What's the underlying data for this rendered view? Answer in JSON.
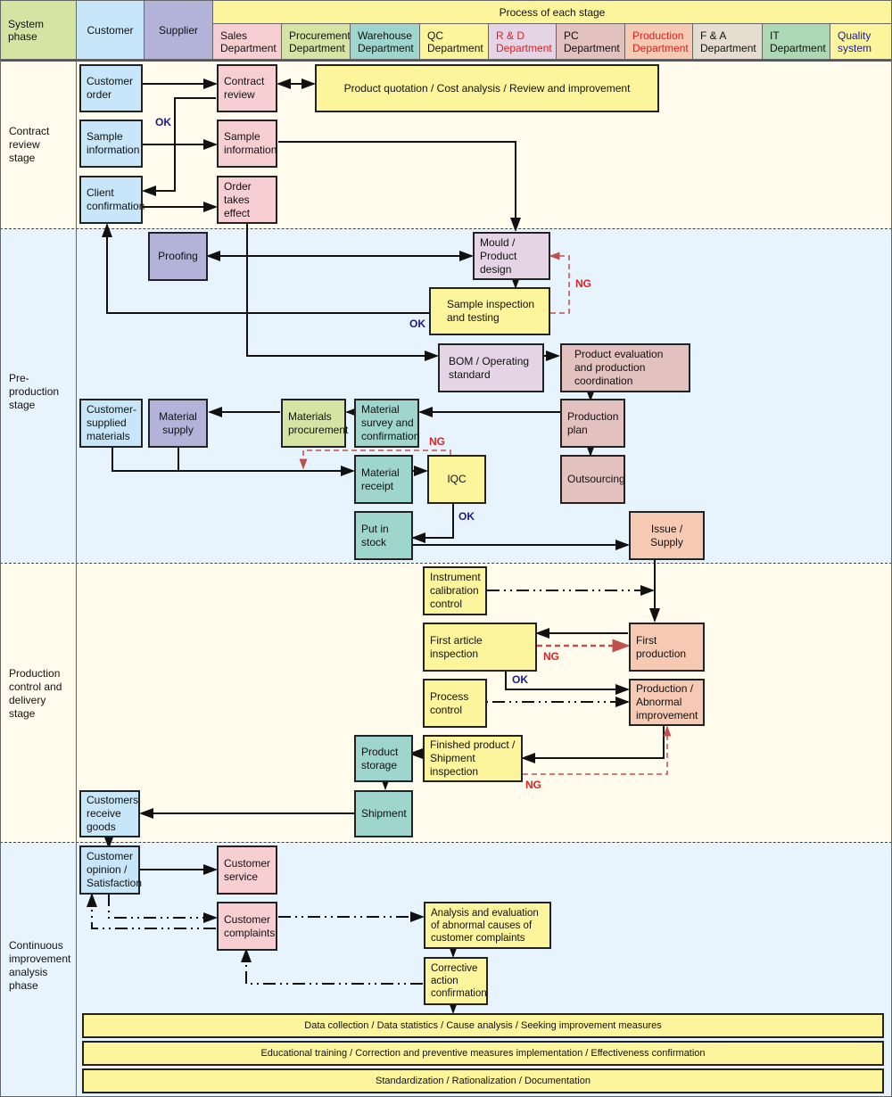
{
  "header": {
    "system_phase": "System phase",
    "customer": "Customer",
    "supplier": "Supplier",
    "process_title": "Process of each stage",
    "departments": [
      {
        "label": "Sales Department",
        "color": "#f7cfd3",
        "text_color": "#111111"
      },
      {
        "label": "Procurement Department",
        "color": "#d6e4a3",
        "text_color": "#111111"
      },
      {
        "label": "Warehouse Department",
        "color": "#9ed5cd",
        "text_color": "#111111"
      },
      {
        "label": "QC Department",
        "color": "#fdf59c",
        "text_color": "#111111"
      },
      {
        "label": "R & D Department",
        "color": "#e4d4e6",
        "text_color": "#e02020"
      },
      {
        "label": "PC Department",
        "color": "#e2c1bf",
        "text_color": "#111111"
      },
      {
        "label": "Production Department",
        "color": "#f6c9b3",
        "text_color": "#e02020"
      },
      {
        "label": "F & A Department",
        "color": "#e5ddd0",
        "text_color": "#111111"
      },
      {
        "label": "IT Department",
        "color": "#acd9b3",
        "text_color": "#111111"
      },
      {
        "label": "Quality system",
        "color": "#fdf59c",
        "text_color": "#1a1a9c"
      }
    ]
  },
  "phases": [
    {
      "label": "Contract review stage"
    },
    {
      "label": "Pre-production stage"
    },
    {
      "label": "Production control and delivery stage"
    },
    {
      "label": "Continuous improvement analysis phase"
    }
  ],
  "nodes": {
    "customer_order": "Customer order",
    "contract_review": "Contract review",
    "product_quotation": "Product quotation / Cost analysis / Review and improvement",
    "sample_info_customer": "Sample information",
    "sample_info_sales": "Sample information",
    "client_confirmation": "Client confirmation",
    "order_takes_effect": "Order takes effect",
    "proofing": "Proofing",
    "mould_design": "Mould / Product design",
    "sample_inspection": "Sample inspection and testing",
    "bom": "BOM / Operating standard",
    "product_evaluation": "Product evaluation and production coordination",
    "customer_supplied": "Customer-supplied materials",
    "material_supply": "Material supply",
    "materials_procurement": "Materials procurement",
    "material_survey": "Material survey and confirmation",
    "production_plan": "Production plan",
    "material_receipt": "Material receipt",
    "iqc": "IQC",
    "outsourcing": "Outsourcing",
    "put_in_stock": "Put in stock",
    "issue_supply": "Issue / Supply",
    "instrument_calibration": "Instrument calibration control",
    "first_article": "First article inspection",
    "first_production": "First production",
    "process_control": "Process control",
    "production_abnormal": "Production / Abnormal improvement",
    "product_storage": "Product storage",
    "finished_inspection": "Finished product / Shipment inspection",
    "customers_receive": "Customers receive goods",
    "shipment": "Shipment",
    "customer_opinion": "Customer opinion / Satisfaction",
    "customer_service": "Customer service",
    "customer_complaints": "Customer complaints",
    "analysis_evaluation": "Analysis and evaluation of abnormal causes of customer complaints",
    "corrective_action": "Corrective action confirmation",
    "data_collection": "Data collection / Data statistics / Cause analysis / Seeking improvement measures",
    "educational_training": "Educational training / Correction and preventive measures implementation / Effectiveness confirmation",
    "standardization": "Standardization / Rationalization / Documentation"
  },
  "labels": {
    "ok": "OK",
    "ng": "NG"
  },
  "colors": {
    "customer": "#c7e6f9",
    "supplier": "#b3b3d9",
    "system_phase": "#d6e4a3",
    "band_cream": "#fffcee",
    "band_blue": "#e8f4fd",
    "ng_line": "#c0504d"
  }
}
